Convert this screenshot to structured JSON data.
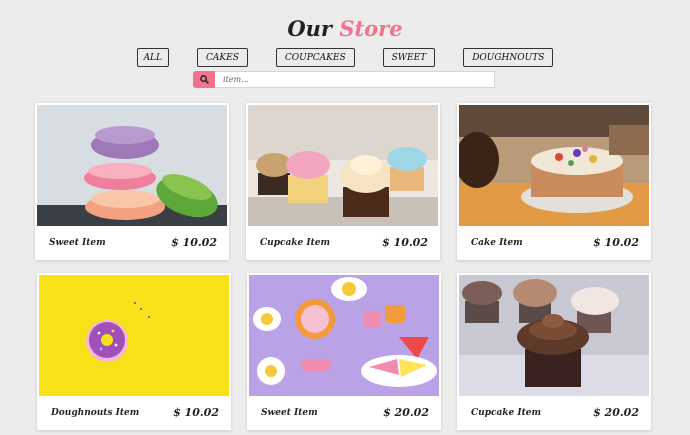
{
  "header": {
    "title_part1": "Our",
    "title_part2": "Store"
  },
  "filters": [
    {
      "label": "ALL"
    },
    {
      "label": "CAKES"
    },
    {
      "label": "COUPCAKES"
    },
    {
      "label": "SWEET"
    },
    {
      "label": "DOUGHNOUTS"
    }
  ],
  "search": {
    "placeholder": "item...",
    "icon": "search-icon"
  },
  "colors": {
    "accent": "#f1738f",
    "background": "#ececec"
  },
  "products": [
    {
      "name": "Sweet Item",
      "price": "$ 10.02",
      "image": "macarons"
    },
    {
      "name": "Cupcake Item",
      "price": "$ 10.02",
      "image": "cupcakes"
    },
    {
      "name": "Cake Item",
      "price": "$ 10.02",
      "image": "cake"
    },
    {
      "name": "Doughnouts Item",
      "price": "$ 10.02",
      "image": "donut"
    },
    {
      "name": "Sweet Item",
      "price": "$ 20.02",
      "image": "sweets"
    },
    {
      "name": "Cupcake Item",
      "price": "$ 20.02",
      "image": "chocolate-cupcakes"
    }
  ]
}
